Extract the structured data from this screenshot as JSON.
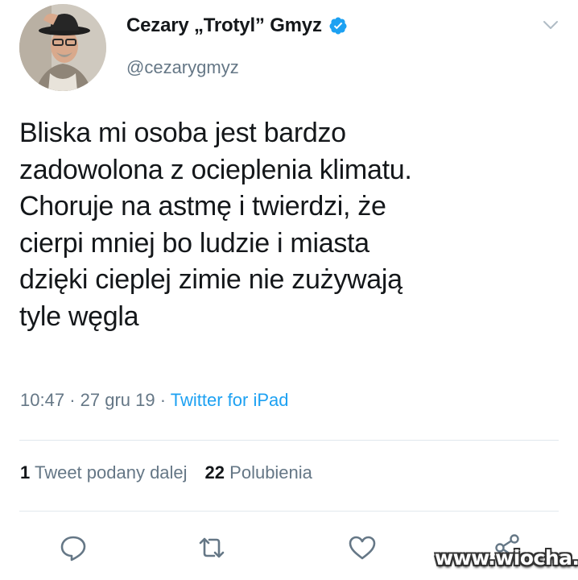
{
  "author": {
    "display_name": "Cezary „Trotyl” Gmyz",
    "handle": "@cezarygmyz",
    "verified": true
  },
  "tweet": {
    "lines": [
      "Bliska mi osoba jest bardzo",
      "zadowolona z ocieplenia klimatu.",
      "Choruje na astmę i twierdzi, że",
      "cierpi mniej bo ludzie i miasta",
      "dzięki cieplej zimie nie zużywają",
      "tyle węgla"
    ],
    "time": "10:47",
    "separator": "·",
    "date": "27 gru 19",
    "source": "Twitter for iPad"
  },
  "stats": {
    "retweet_count": "1",
    "retweet_label": "Tweet podany dalej",
    "like_count": "22",
    "like_label": "Polubienia"
  },
  "icons": {
    "menu": "chevron-down-icon",
    "reply": "reply-icon",
    "retweet": "retweet-icon",
    "like": "heart-icon",
    "share": "share-icon",
    "verified": "verified-badge-icon"
  },
  "colors": {
    "text": "#14171a",
    "secondary": "#657786",
    "accent": "#1da1f2",
    "divider": "#e1e8ed"
  },
  "watermark": "www.wiocha.pl"
}
